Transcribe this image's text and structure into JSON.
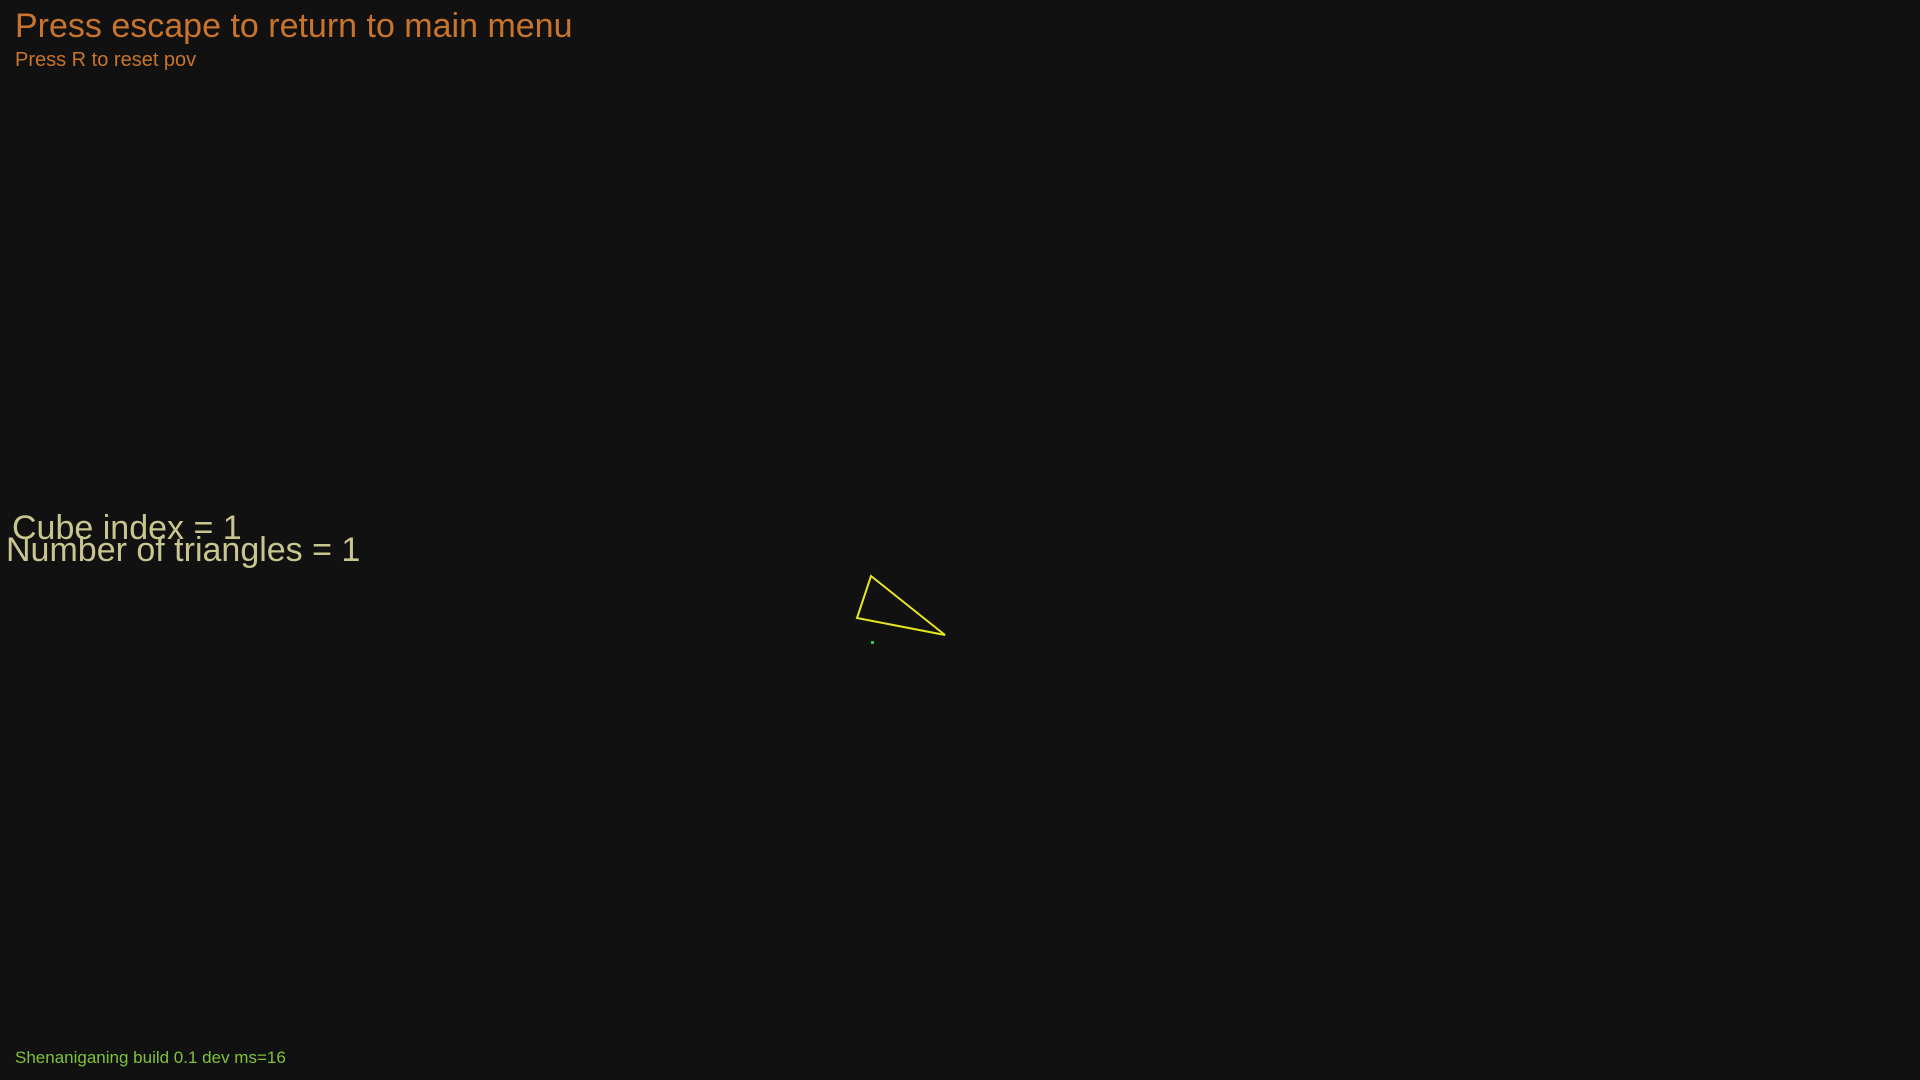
{
  "hud": {
    "title": "Press escape to return to main menu",
    "subtitle": "Press R to reset pov",
    "cube_index": "Cube index = 1",
    "triangle_count": "Number of triangles = 1",
    "build_info": "Shenaniganing build 0.1 dev ms=16"
  },
  "colors": {
    "background": "#111111",
    "hud_orange": "#c8742c",
    "hud_khaki": "#c9c58f",
    "build_green": "#7fc23a",
    "triangle_yellow": "#e6e61e",
    "origin_dot_green": "#2ecc40"
  }
}
